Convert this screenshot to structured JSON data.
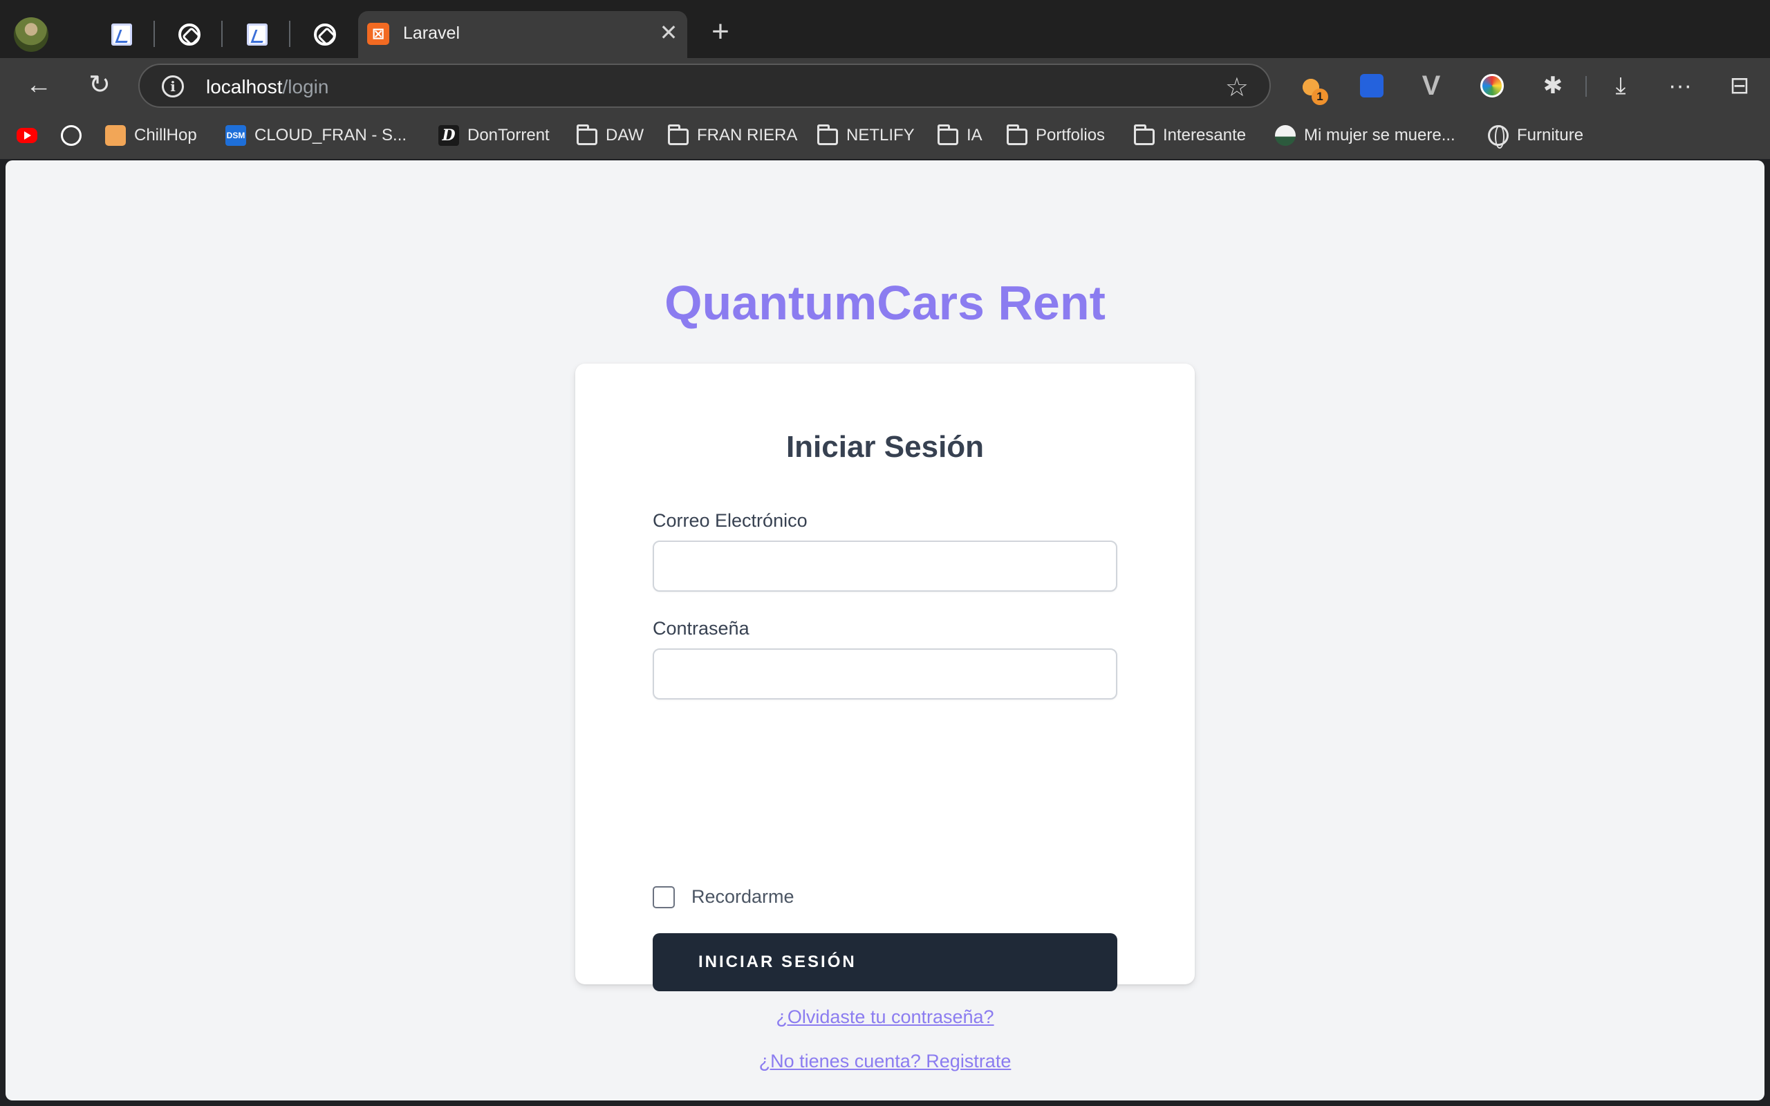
{
  "browser": {
    "tabs": {
      "active_title": "Laravel",
      "close_glyph": "✕",
      "new_tab_glyph": "+"
    },
    "toolbar": {
      "back_glyph": "←",
      "reload_glyph": "↻",
      "info_glyph": "i",
      "url_host": "localhost",
      "url_path": "/login",
      "star_glyph": "☆",
      "extension_badge": "1",
      "download_glyph": "⤓",
      "more_glyph": "···",
      "sidebar_glyph": "⊟"
    },
    "bookmarks": [
      {
        "label": "ChillHop"
      },
      {
        "label": "CLOUD_FRAN - S..."
      },
      {
        "label": "DonTorrent"
      },
      {
        "label": "DAW"
      },
      {
        "label": "FRAN RIERA"
      },
      {
        "label": "NETLIFY"
      },
      {
        "label": "IA"
      },
      {
        "label": "Portfolios"
      },
      {
        "label": "Interesante"
      },
      {
        "label": "Mi mujer se muere..."
      },
      {
        "label": "Furniture"
      }
    ]
  },
  "page": {
    "brand": "QuantumCars Rent",
    "accent_color": "#8b7cf0",
    "form": {
      "title": "Iniciar Sesión",
      "email_label": "Correo Electrónico",
      "email_value": "",
      "password_label": "Contraseña",
      "password_value": "",
      "remember_label": "Recordarme",
      "remember_checked": false,
      "submit_label": "INICIAR SESIÓN",
      "forgot_link": "¿Olvidaste tu contraseña?",
      "register_link": "¿No tienes cuenta? Registrate"
    }
  }
}
